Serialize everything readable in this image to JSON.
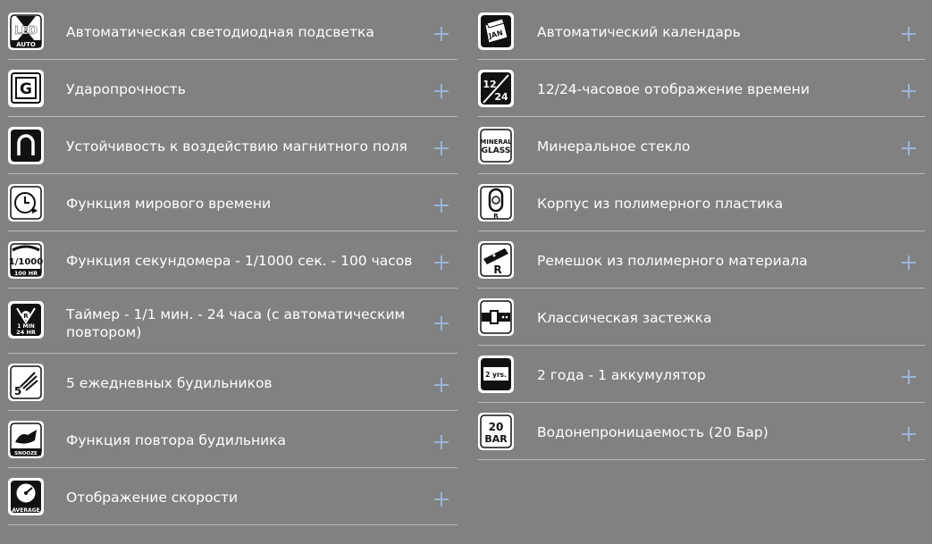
{
  "features_left": [
    {
      "label": "Автоматическая светодиодная подсветка",
      "icon": "led-auto-icon",
      "icon_text": [
        "LED",
        "AUTO"
      ]
    },
    {
      "label": "Ударопрочность",
      "icon": "shock-resist-icon",
      "icon_text": [
        "G"
      ]
    },
    {
      "label": "Устойчивость к воздействию магнитного поля",
      "icon": "magnet-icon"
    },
    {
      "label": "Функция мирового времени",
      "icon": "world-time-icon"
    },
    {
      "label": "Функция секундомера - 1/1000 сек. - 100 часов",
      "icon": "stopwatch-icon",
      "icon_text": [
        "1/1000",
        "100 HR"
      ]
    },
    {
      "label": "Таймер - 1/1 мин. - 24 часа (с автоматическим повтором)",
      "icon": "timer-icon",
      "icon_text": [
        "R",
        "1 MIN",
        "24 HR"
      ]
    },
    {
      "label": "5 ежедневных будильников",
      "icon": "alarm-icon",
      "icon_text": [
        "5"
      ]
    },
    {
      "label": "Функция повтора будильника",
      "icon": "snooze-icon",
      "icon_text": [
        "SNOOZE"
      ]
    },
    {
      "label": "Отображение скорости",
      "icon": "speed-icon",
      "icon_text": [
        "AVERAGE"
      ]
    }
  ],
  "features_right": [
    {
      "label": "Автоматический календарь",
      "icon": "calendar-icon",
      "icon_text": [
        "JAN"
      ]
    },
    {
      "label": "12/24-часовое отображение времени",
      "icon": "12-24-icon",
      "icon_text": [
        "12",
        "24"
      ]
    },
    {
      "label": "Минеральное стекло",
      "icon": "mineral-glass-icon",
      "icon_text": [
        "MINERAL",
        "GLASS"
      ]
    },
    {
      "label": "Корпус из полимерного пластика",
      "icon": "resin-case-icon",
      "icon_text": [
        "R"
      ]
    },
    {
      "label": "Ремешок из полимерного материала",
      "icon": "resin-band-icon",
      "icon_text": [
        "R"
      ]
    },
    {
      "label": "Классическая застежка",
      "icon": "buckle-icon"
    },
    {
      "label": "2 года - 1 аккумулятор",
      "icon": "battery-icon",
      "icon_text": [
        "2 yrs."
      ]
    },
    {
      "label": "Водонепроницаемость (20 Бар)",
      "icon": "water-resist-icon",
      "icon_text": [
        "20",
        "BAR"
      ]
    }
  ],
  "colors": {
    "background": "#818181",
    "divider": "#b9b9b9",
    "plus": "#9bb4d6",
    "text": "#ffffff"
  }
}
